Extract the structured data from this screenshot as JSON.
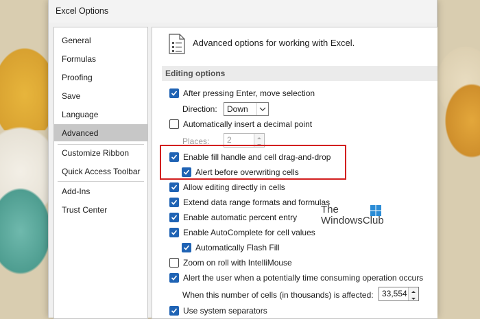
{
  "window": {
    "title": "Excel Options"
  },
  "nav": {
    "items": [
      {
        "label": "General"
      },
      {
        "label": "Formulas"
      },
      {
        "label": "Proofing"
      },
      {
        "label": "Save"
      },
      {
        "label": "Language"
      },
      {
        "label": "Advanced"
      },
      {
        "label": "Customize Ribbon"
      },
      {
        "label": "Quick Access Toolbar"
      },
      {
        "label": "Add-Ins"
      },
      {
        "label": "Trust Center"
      }
    ],
    "selected": "Advanced"
  },
  "header": {
    "text": "Advanced options for working with Excel.",
    "icon": "options-page-icon"
  },
  "section": {
    "title": "Editing options"
  },
  "options": {
    "after_enter": {
      "label": "After pressing Enter, move selection",
      "checked": true
    },
    "direction": {
      "label": "Direction:",
      "value": "Down"
    },
    "decimal_point": {
      "label": "Automatically insert a decimal point",
      "checked": false
    },
    "places": {
      "label": "Places:",
      "value": "2"
    },
    "fill_handle": {
      "label": "Enable fill handle and cell drag-and-drop",
      "checked": true
    },
    "alert_overwrite": {
      "label": "Alert before overwriting cells",
      "checked": true
    },
    "edit_in_cells": {
      "label": "Allow editing directly in cells",
      "checked": true
    },
    "extend_formats": {
      "label": "Extend data range formats and formulas",
      "checked": true
    },
    "percent_entry": {
      "label": "Enable automatic percent entry",
      "checked": true
    },
    "autocomplete": {
      "label": "Enable AutoComplete for cell values",
      "checked": true
    },
    "flash_fill": {
      "label": "Automatically Flash Fill",
      "checked": true
    },
    "zoom_roll": {
      "label": "Zoom on roll with IntelliMouse",
      "checked": false
    },
    "alert_time": {
      "label": "Alert the user when a potentially time consuming operation occurs",
      "checked": true
    },
    "cells_affected": {
      "label": "When this number of cells (in thousands) is affected:",
      "value": "33,554"
    },
    "system_separators": {
      "label": "Use system separators",
      "checked": true
    }
  },
  "watermark": {
    "line1": "The",
    "line2": "WindowsClub"
  },
  "colors": {
    "accent": "#1f63b4",
    "highlight": "#d21f1f",
    "selected_nav": "#c7c7c7"
  }
}
